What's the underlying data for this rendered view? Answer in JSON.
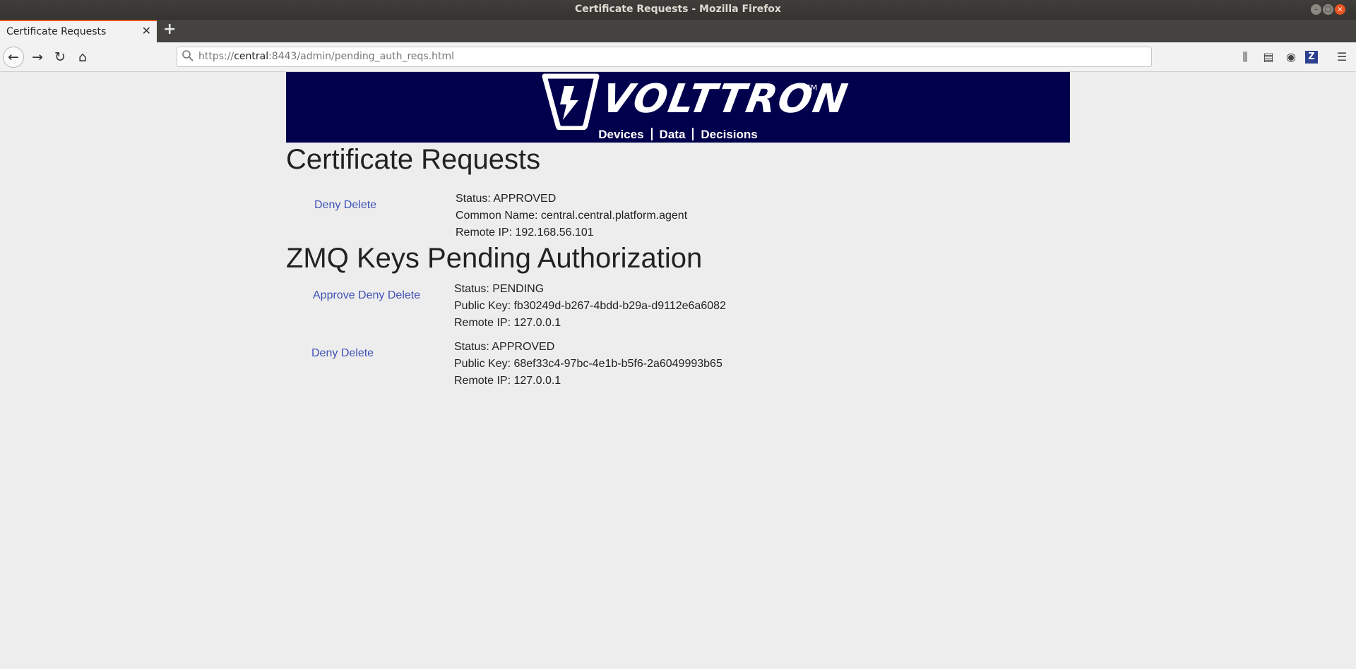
{
  "window": {
    "title": "Certificate Requests - Mozilla Firefox"
  },
  "tab": {
    "label": "Certificate Requests",
    "close": "✕",
    "new_tab": "+"
  },
  "nav": {
    "url_scheme": "https://",
    "url_host": "central",
    "url_rest": ":8443/admin/pending_auth_reqs.html"
  },
  "banner": {
    "brand": "VOLTTRON",
    "trademark": "TM",
    "links": [
      "Devices",
      "Data",
      "Decisions"
    ],
    "bg_color": "#00004d"
  },
  "cert_section": {
    "heading": "Certificate Requests",
    "requests": [
      {
        "actions": [
          "Deny",
          "Delete"
        ],
        "status": "Status: APPROVED",
        "common_name": "Common Name: central.central.platform.agent",
        "remote_ip": "Remote IP: 192.168.56.101"
      }
    ]
  },
  "zmq_section": {
    "heading": "ZMQ Keys Pending Authorization",
    "keys": [
      {
        "actions": [
          "Approve",
          "Deny",
          "Delete"
        ],
        "status": "Status: PENDING",
        "public_key": "Public Key: fb30249d-b267-4bdd-b29a-d9112e6a6082",
        "remote_ip": "Remote IP: 127.0.0.1"
      },
      {
        "actions": [
          "Deny",
          "Delete"
        ],
        "status": "Status: APPROVED",
        "public_key": "Public Key: 68ef33c4-97bc-4e1b-b5f6-2a6049993b65",
        "remote_ip": "Remote IP: 127.0.0.1"
      }
    ]
  },
  "link_color": "#3f51b5"
}
